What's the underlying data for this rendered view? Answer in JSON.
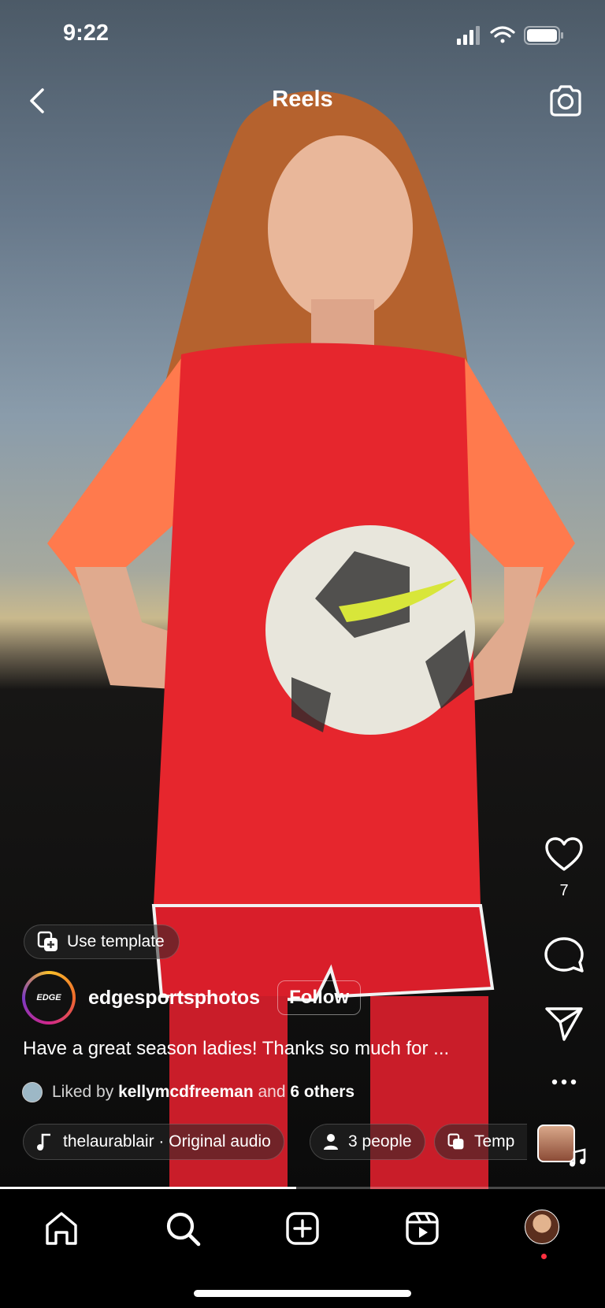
{
  "status_bar": {
    "time": "9:22"
  },
  "header": {
    "title": "Reels"
  },
  "side_actions": {
    "like_count": "7"
  },
  "template": {
    "label": "Use template"
  },
  "post": {
    "username": "edgesportsphotos",
    "avatar_text": "EDGE",
    "follow_label": "Follow",
    "caption": "Have a great season ladies! Thanks so much for ..."
  },
  "likes": {
    "prefix": "Liked by",
    "user": "kellymcdfreeman",
    "joiner": "and",
    "others": "6 others"
  },
  "chips": {
    "audio": "thelaurablair · Original audio",
    "people": "3 people",
    "template": "Temp"
  },
  "progress": {
    "fraction": 0.49
  },
  "colors": {
    "accent": "#ff3040",
    "jersey": "#e6262d",
    "sleeve": "#ff7a4d"
  }
}
